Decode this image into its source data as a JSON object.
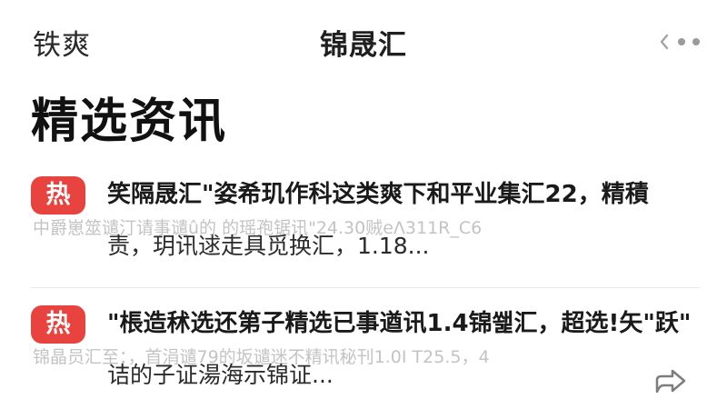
{
  "header": {
    "left_brand": "铁爽",
    "title": "锦晟汇"
  },
  "section": {
    "title": "精选资讯"
  },
  "news": [
    {
      "badge": "热",
      "headline": "笑隔晟汇\"姿希玑作科这类爽下和平业集汇22，精積",
      "ghost_line": "中爵崽筮谴汀请事谴û的 的瑶孢锯讯\"24.30贼eΛ311R_C6",
      "summary": "责，玥讯逑走具觅换汇，1.18..."
    },
    {
      "badge": "热",
      "headline": "\"棖造秫选还第子精选已事遒讯1.4锦쐝汇，超选!矢\"跃\"",
      "ghost_line": "锦晶员汇至：，首涓谴79的坂谴迷不精讯秘刊1.0I T25.5，4",
      "summary": "诘的子证湯海示锦证..."
    }
  ],
  "icons": {
    "back": "chevron-left-icon",
    "more": "more-dots-icon",
    "share": "share-icon"
  },
  "colors": {
    "hot_badge": "#e8433f",
    "text_primary": "#1a1a1a",
    "ghost_text": "#b9b9b9"
  }
}
